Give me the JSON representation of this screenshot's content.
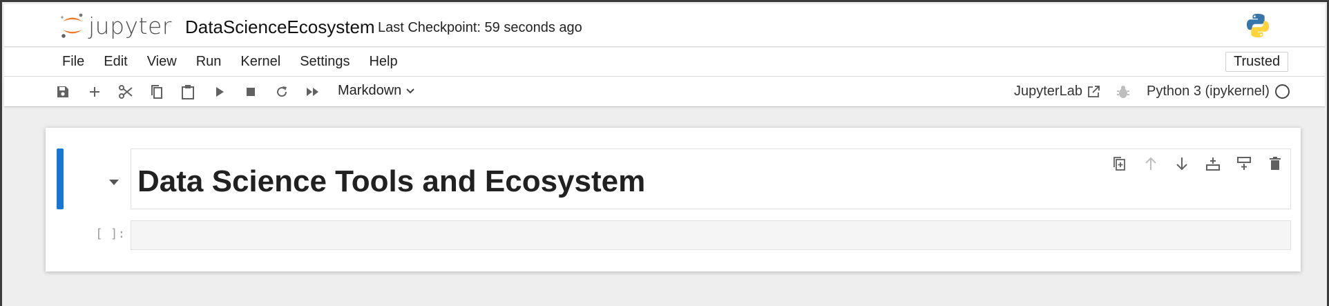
{
  "header": {
    "logo_text": "jupyter",
    "notebook_title": "DataScienceEcosystem",
    "checkpoint": "Last Checkpoint: 59 seconds ago",
    "kernel_logo_icon": "python-logo-icon"
  },
  "menubar": {
    "items": [
      "File",
      "Edit",
      "View",
      "Run",
      "Kernel",
      "Settings",
      "Help"
    ],
    "trusted_label": "Trusted"
  },
  "toolbar": {
    "icons": [
      "save-icon",
      "add-cell-icon",
      "cut-icon",
      "copy-icon",
      "paste-icon",
      "run-icon",
      "stop-icon",
      "restart-icon",
      "fast-forward-icon"
    ],
    "cell_type": "Markdown",
    "jupyterlab_label": "JupyterLab",
    "kernel_name": "Python 3 (ipykernel)"
  },
  "notebook": {
    "markdown_cell": {
      "heading": "Data Science Tools and Ecosystem",
      "tools": [
        "duplicate-icon",
        "move-up-icon",
        "move-down-icon",
        "insert-above-icon",
        "insert-below-icon",
        "delete-icon"
      ]
    },
    "code_cell": {
      "prompt": "[ ]:",
      "source": ""
    }
  },
  "colors": {
    "active_cell_bar": "#1976d2",
    "jupyter_orange": "#f37726",
    "python_blue": "#3776ab",
    "python_yellow": "#ffd43b"
  }
}
